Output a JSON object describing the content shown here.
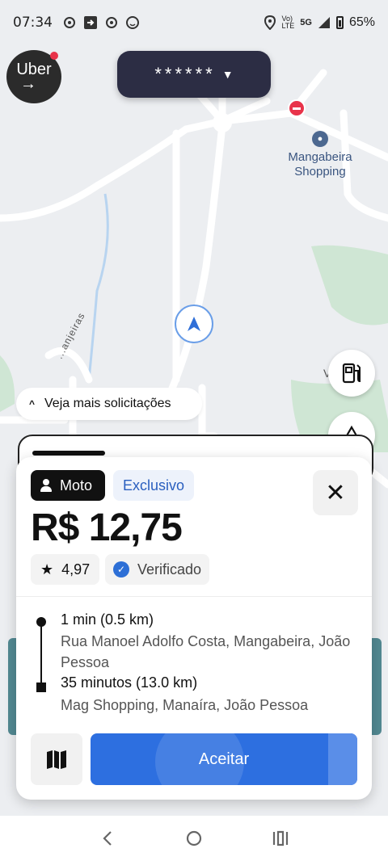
{
  "status_bar": {
    "time": "07:34",
    "network": "5G",
    "battery": "65%"
  },
  "header": {
    "logo_text": "Uber",
    "masked_earnings": "******"
  },
  "map": {
    "poi_name": "Mangabeira Shopping",
    "street_label": "...anjeiras",
    "side_label": "V"
  },
  "more_requests": {
    "label": "Veja mais solicitações"
  },
  "request": {
    "type_label": "Moto",
    "exclusive_label": "Exclusivo",
    "price": "R$ 12,75",
    "rating": "4,97",
    "verified_label": "Verificado",
    "pickup_time": "1 min (0.5 km)",
    "pickup_address": "Rua Manoel Adolfo Costa, Mangabeira, João Pessoa",
    "trip_time": "35 minutos (13.0 km)",
    "dropoff_address": "Mag Shopping, Manaíra, João Pessoa",
    "accept_label": "Aceitar"
  },
  "colors": {
    "accent": "#2d6fe0",
    "pill_bg": "#2c2d44",
    "badge_dark": "#111111",
    "map_bg": "#eceef1"
  }
}
